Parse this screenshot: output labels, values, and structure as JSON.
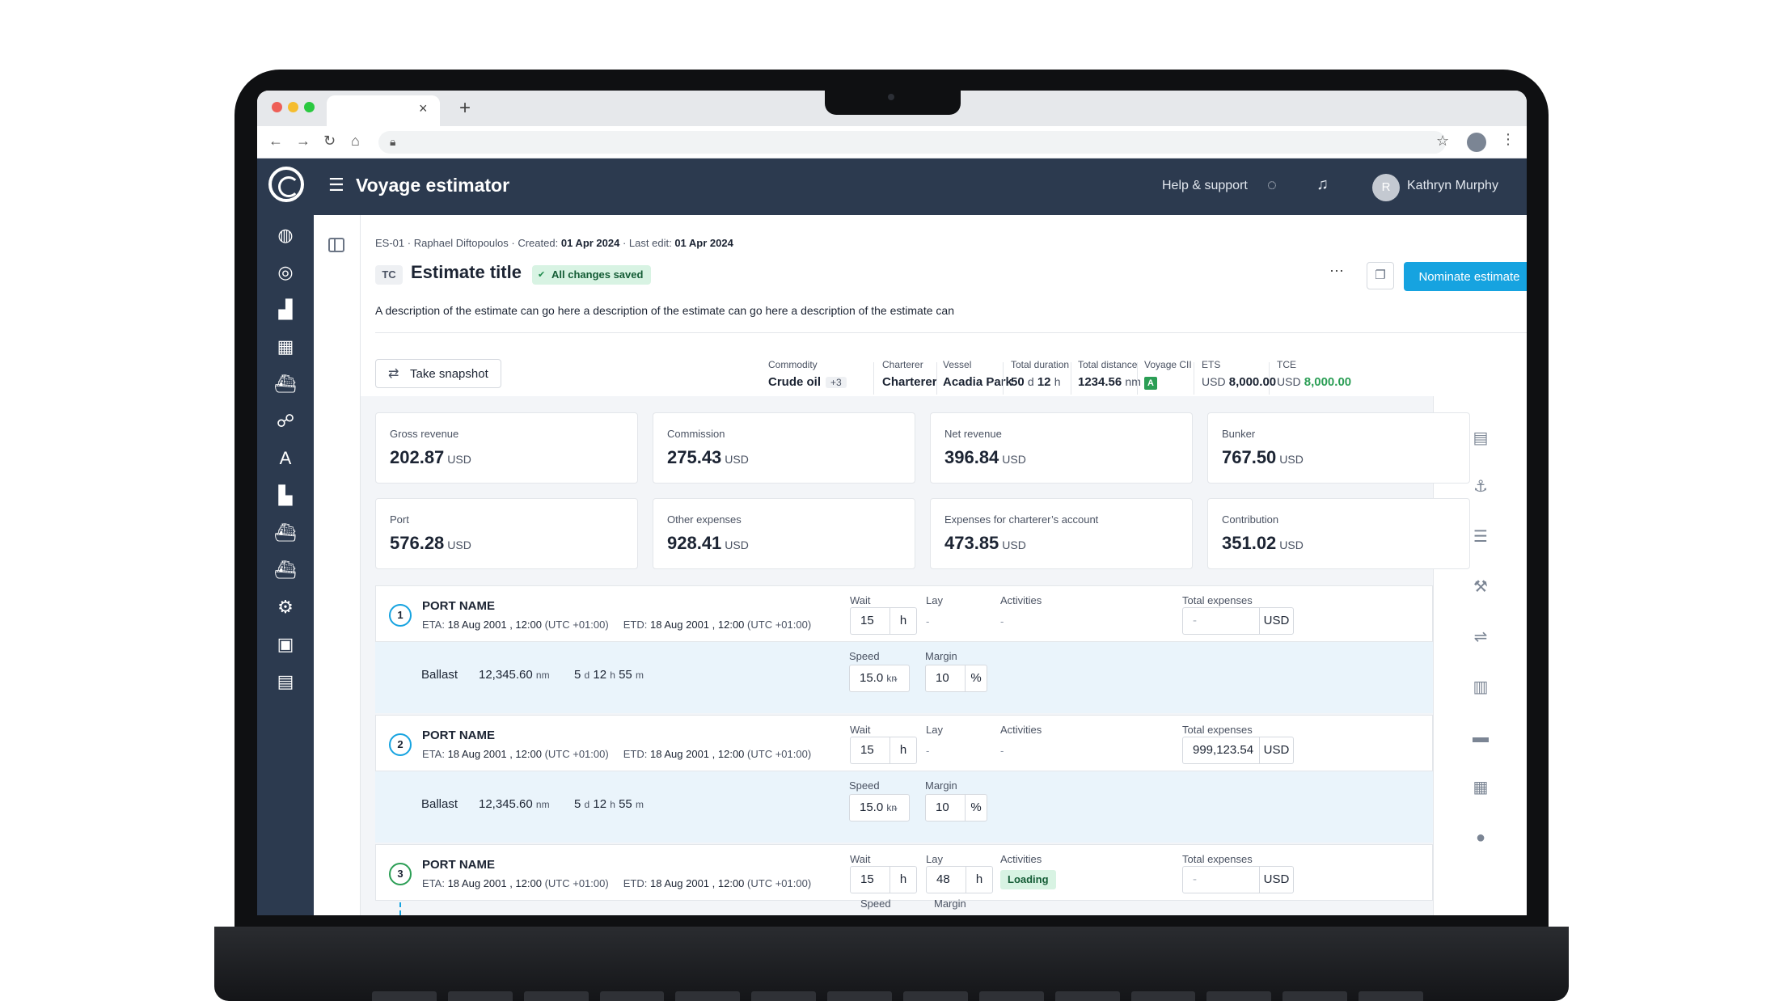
{
  "browser": {
    "tab_close": "×",
    "tab_new": "+"
  },
  "app": {
    "title": "Voyage estimator",
    "help": "Help & support",
    "user_initial": "R",
    "user_name": "Kathryn Murphy"
  },
  "estimate": {
    "id": "ES-01",
    "author": "Raphael Diftopoulos",
    "created_label": "Created:",
    "created": "01 Apr 2024",
    "last_edit_label": "Last edit:",
    "last_edit": "01 Apr 2024",
    "type_badge": "TC",
    "title": "Estimate title",
    "saved": "All changes saved",
    "more": "···",
    "nominate": "Nominate estimate",
    "description": "A description of the estimate can go here a description of the estimate can go here a description of the estimate can"
  },
  "snapshot": {
    "label": "Take snapshot"
  },
  "summary": {
    "commodity": {
      "label": "Commodity",
      "value": "Crude oil",
      "extra": "+3"
    },
    "charterer": {
      "label": "Charterer",
      "value": "Charterer"
    },
    "vessel": {
      "label": "Vessel",
      "value": "Acadia Park"
    },
    "duration": {
      "label": "Total duration",
      "days": "50",
      "d": "d",
      "hours": "12",
      "h": "h"
    },
    "distance": {
      "label": "Total distance",
      "value": "1234.56",
      "unit": "nm"
    },
    "cii": {
      "label": "Voyage CII",
      "value": "A"
    },
    "ets": {
      "label": "ETS",
      "currency": "USD",
      "value": "8,000.00"
    },
    "tce": {
      "label": "TCE",
      "currency": "USD",
      "value": "8,000.00"
    }
  },
  "cards": [
    {
      "label": "Gross revenue",
      "value": "202.87",
      "currency": "USD"
    },
    {
      "label": "Commission",
      "value": "275.43",
      "currency": "USD"
    },
    {
      "label": "Net revenue",
      "value": "396.84",
      "currency": "USD"
    },
    {
      "label": "Bunker",
      "value": "767.50",
      "currency": "USD"
    },
    {
      "label": "Port",
      "value": "576.28",
      "currency": "USD"
    },
    {
      "label": "Other expenses",
      "value": "928.41",
      "currency": "USD"
    },
    {
      "label": "Expenses for charterer’s account",
      "value": "473.85",
      "currency": "USD"
    },
    {
      "label": "Contribution",
      "value": "351.02",
      "currency": "USD"
    }
  ],
  "labels": {
    "wait": "Wait",
    "lay": "Lay",
    "activities": "Activities",
    "total_expenses": "Total expenses",
    "speed": "Speed",
    "margin": "Margin",
    "h": "h",
    "pct": "%",
    "usd": "USD",
    "kn": "kn",
    "dash": "-",
    "eta": "ETA:",
    "etd": "ETD:"
  },
  "ports": [
    {
      "num": "1",
      "name": "PORT NAME",
      "eta": "18 Aug 2001 , 12:00",
      "eta_tz": "(UTC +01:00)",
      "etd": "18 Aug 2001 , 12:00",
      "etd_tz": "(UTC +01:00)",
      "wait": "15",
      "lay": "-",
      "activity": "-",
      "expenses": "-"
    },
    {
      "num": "2",
      "name": "PORT NAME",
      "eta": "18 Aug 2001 , 12:00",
      "eta_tz": "(UTC +01:00)",
      "etd": "18 Aug 2001 , 12:00",
      "etd_tz": "(UTC +01:00)",
      "wait": "15",
      "lay": "-",
      "activity": "-",
      "expenses": "999,123.54"
    },
    {
      "num": "3",
      "name": "PORT NAME",
      "eta": "18 Aug 2001 , 12:00",
      "eta_tz": "(UTC +01:00)",
      "etd": "18 Aug 2001 , 12:00",
      "etd_tz": "(UTC +01:00)",
      "wait": "15",
      "lay": "48",
      "activity": "Loading",
      "expenses": "-"
    }
  ],
  "legs": [
    {
      "label": "Ballast",
      "distance": "12,345.60",
      "dist_unit": "nm",
      "days": "5",
      "hours": "12",
      "minutes": "55",
      "d": "d",
      "h": "h",
      "m": "m",
      "speed": "15.0",
      "margin": "10"
    },
    {
      "label": "Ballast",
      "distance": "12,345.60",
      "dist_unit": "nm",
      "days": "5",
      "hours": "12",
      "minutes": "55",
      "d": "d",
      "h": "h",
      "m": "m",
      "speed": "15.0",
      "margin": "10"
    }
  ],
  "colors": {
    "navy": "#2c3a4f",
    "accent": "#16a3e0",
    "success": "#2b9e55",
    "success_bg": "#d8f3e3"
  }
}
